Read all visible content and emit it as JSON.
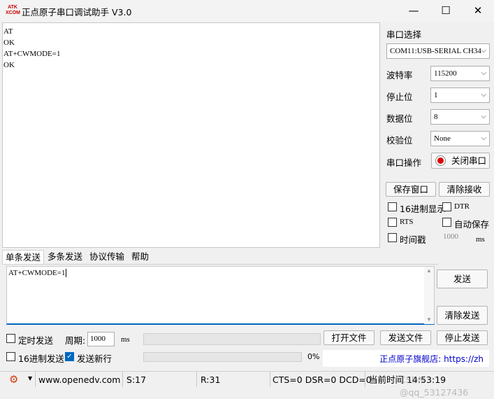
{
  "window": {
    "title": "正点原子串口调试助手 V3.0",
    "logo_text": "ATK\nXCOM",
    "minimize": "—",
    "maximize": "☐",
    "close": "✕"
  },
  "receive": {
    "lines": [
      "AT",
      "OK",
      "AT+CWMODE=1",
      "OK"
    ]
  },
  "panel": {
    "port_select_label": "串口选择",
    "port_value": "COM11:USB-SERIAL CH34",
    "baud_label": "波特率",
    "baud_value": "115200",
    "stop_label": "停止位",
    "stop_value": "1",
    "data_label": "数据位",
    "data_value": "8",
    "parity_label": "校验位",
    "parity_value": "None",
    "port_op_label": "串口操作",
    "close_port_btn": "关闭串口",
    "save_window_btn": "保存窗口",
    "clear_recv_btn": "清除接收",
    "hex_display": "16进制显示",
    "dtr": "DTR",
    "rts": "RTS",
    "auto_save": "自动保存",
    "timestamp": "时间戳",
    "timestamp_ms": "1000",
    "ms_unit": "ms",
    "hex_display_checked": false,
    "dtr_checked": false,
    "rts_checked": false,
    "auto_save_checked": false,
    "timestamp_checked": false
  },
  "tabs": [
    "单条发送",
    "多条发送",
    "协议传输",
    "帮助"
  ],
  "send": {
    "text": "AT+CWMODE=1",
    "send_btn": "发送",
    "clear_send_btn": "清除发送",
    "timed_send": "定时发送",
    "timed_send_checked": false,
    "period_label": "周期:",
    "period_value": "1000",
    "period_unit": "ms",
    "open_file_btn": "打开文件",
    "send_file_btn": "发送文件",
    "stop_send_btn": "停止发送",
    "hex_send": "16进制发送",
    "hex_send_checked": false,
    "send_newline": "发送新行",
    "send_newline_checked": true,
    "progress_percent": "0%",
    "progress_value": 0,
    "forum_link": "正点原子旗舰店: https://zh"
  },
  "statusbar": {
    "website": "www.openedv.com",
    "sent": "S:17",
    "received": "R:31",
    "lines": "CTS=0 DSR=0 DCD=0",
    "time": "当前时间 14:53:19",
    "watermark": "CSDN @qq_53127436"
  },
  "colors": {
    "accent": "#0067c0",
    "link": "#0000cc",
    "red_indicator": "#e00000"
  }
}
